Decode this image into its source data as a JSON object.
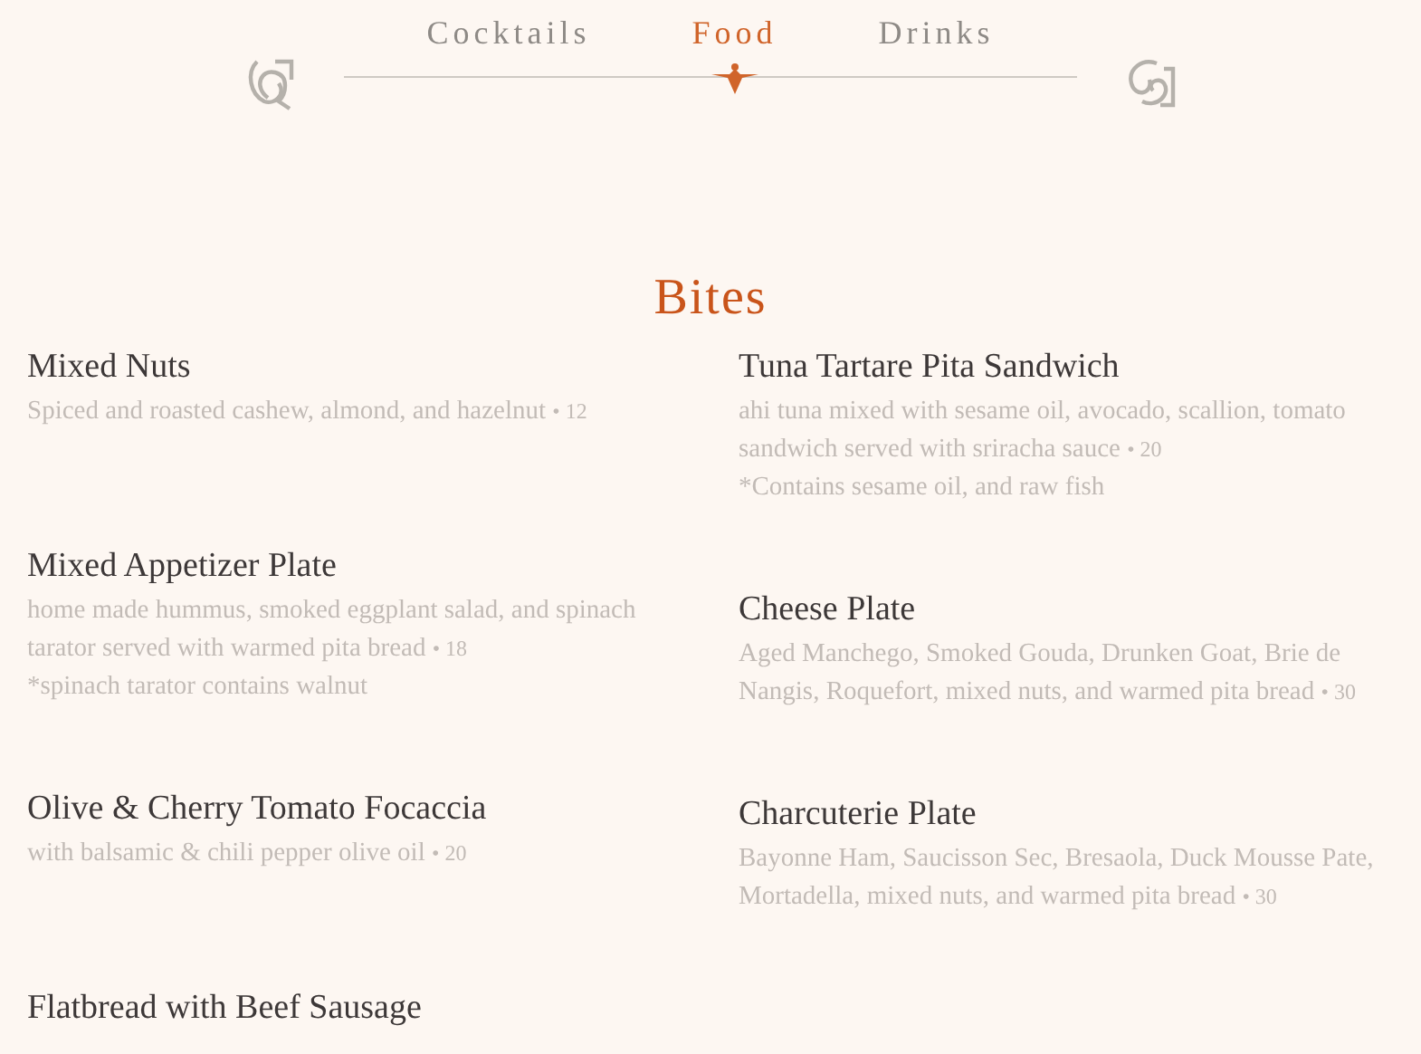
{
  "tabs": [
    {
      "label": "Cocktails",
      "selected": false
    },
    {
      "label": "Food",
      "selected": true
    },
    {
      "label": "Drinks",
      "selected": false
    }
  ],
  "section_title": "Bites",
  "columns": [
    [
      {
        "name": "Mixed Nuts",
        "description": "Spiced and roasted cashew, almond, and hazelnut",
        "price": "• 12"
      },
      {
        "name": "Mixed Appetizer Plate",
        "description": "home made hummus, smoked eggplant salad, and spinach tarator served with warmed pita bread",
        "price": "• 18",
        "note": "*spinach tarator contains walnut"
      },
      {
        "name": "Olive & Cherry Tomato Focaccia",
        "description": "with balsamic & chili pepper olive oil",
        "price": "• 20"
      },
      {
        "name": "Flatbread with Beef Sausage"
      }
    ],
    [
      {
        "name": "Tuna Tartare Pita Sandwich",
        "description": "ahi tuna mixed with sesame oil, avocado, scallion, tomato sandwich served with sriracha sauce",
        "price": "• 20",
        "note": "*Contains sesame oil, and raw fish"
      },
      {
        "name": "Cheese Plate",
        "description": "Aged Manchego, Smoked Gouda, Drunken Goat, Brie de Nangis, Roquefort, mixed nuts, and warmed pita bread",
        "price": "• 30"
      },
      {
        "name": "Charcuterie Plate",
        "description": "Bayonne Ham, Saucisson Sec, Bresaola, Duck Mousse Pate, Mortadella, mixed nuts, and warmed pita bread",
        "price": "• 30"
      }
    ]
  ]
}
